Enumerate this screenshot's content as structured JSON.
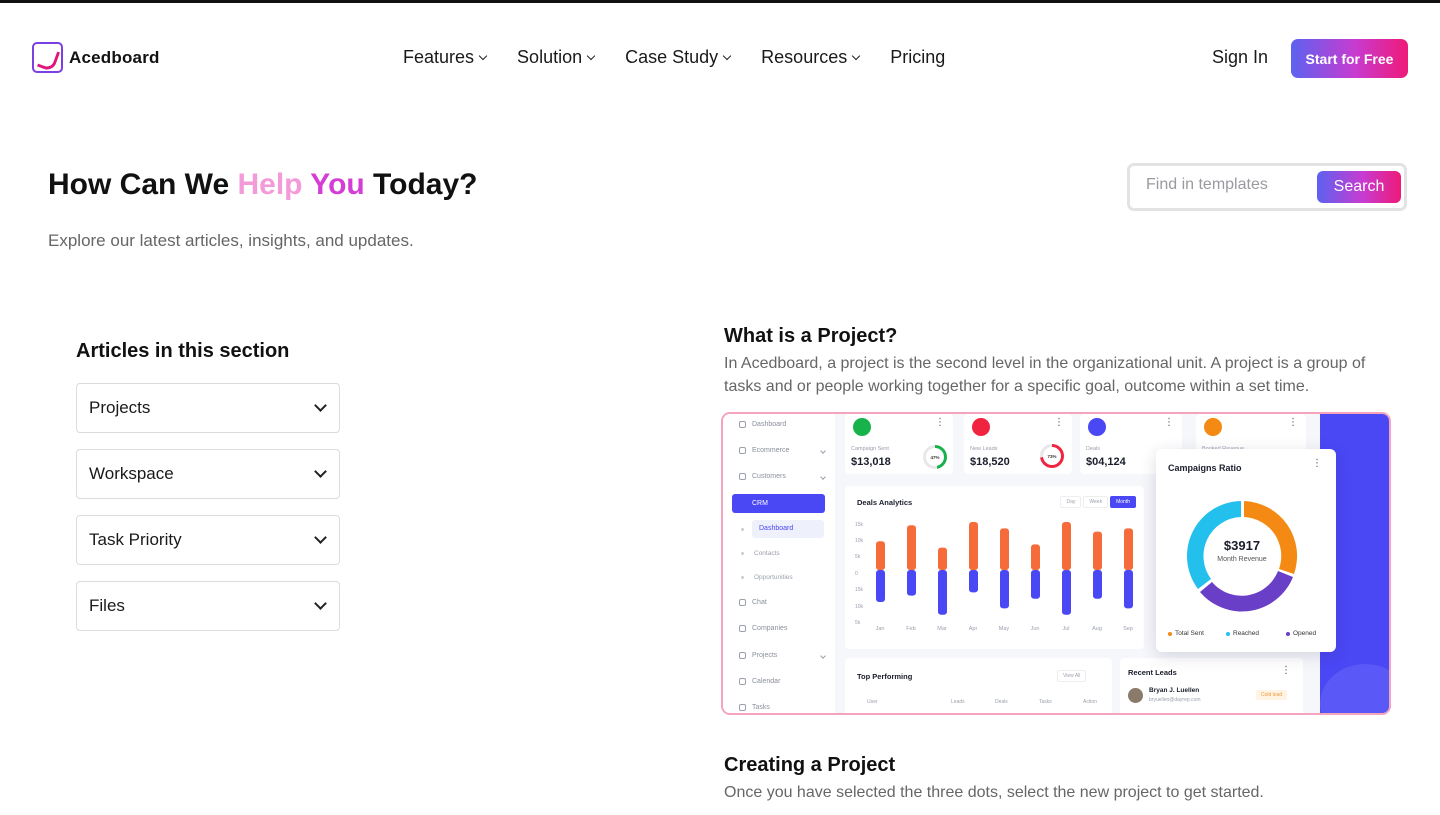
{
  "brand": {
    "name": "Acedboard"
  },
  "nav": {
    "items": [
      {
        "label": "Features",
        "dropdown": true
      },
      {
        "label": "Solution",
        "dropdown": true
      },
      {
        "label": "Case Study",
        "dropdown": true
      },
      {
        "label": "Resources",
        "dropdown": true
      },
      {
        "label": "Pricing",
        "dropdown": false
      }
    ],
    "sign_in": "Sign In",
    "cta": "Start for Free"
  },
  "hero": {
    "title_pre": "How Can We ",
    "title_hl1": "Help ",
    "title_hl2": "You",
    "title_post": " Today?",
    "subtitle": "Explore our latest articles, insights, and updates."
  },
  "search": {
    "placeholder": "Find in templates",
    "button": "Search"
  },
  "sidebar": {
    "title": "Articles in this section",
    "items": [
      "Projects",
      "Workspace",
      "Task Priority",
      "Files"
    ]
  },
  "article": {
    "h1": "What is a Project?",
    "p1": "In Acedboard, a project is the second level in the organizational unit. A project is a group of tasks and or people working together for a specific goal, outcome within a set time.",
    "h2": "Creating a Project",
    "p2": "Once you have selected the three dots, select the new project to get started."
  },
  "mock": {
    "menu": [
      "Dashboard",
      "Ecommerce",
      "Customers",
      "CRM",
      "Chat",
      "Companies",
      "Projects",
      "Calendar",
      "Tasks"
    ],
    "crm_sub": [
      "Dashboard",
      "Contacts",
      "Opportunities"
    ],
    "kpis": [
      {
        "label": "Campaign Sent",
        "value": "$13,018",
        "pct": "47%",
        "color": "#18b24b"
      },
      {
        "label": "New Leads",
        "value": "$18,520",
        "pct": "73%",
        "color": "#f1243f"
      },
      {
        "label": "Deals",
        "value": "$04,124",
        "pct": "",
        "color": "#4a47f5"
      },
      {
        "label": "Booked Revenue",
        "value": "",
        "pct": "",
        "color": "#f48a13"
      }
    ],
    "deals": {
      "title": "Deals Analytics",
      "tabs": [
        "Day",
        "Week",
        "Month"
      ],
      "y_ticks": [
        "15k",
        "10k",
        "5k",
        "0",
        "15k",
        "10k",
        "5k"
      ],
      "months": [
        "Jan",
        "Feb",
        "Mar",
        "Apr",
        "May",
        "Jun",
        "Jul",
        "Aug",
        "Sep"
      ],
      "upper": [
        9,
        14,
        7,
        15,
        13,
        8,
        15,
        12,
        13
      ],
      "lower": [
        10,
        8,
        14,
        7,
        12,
        9,
        14,
        9,
        12
      ],
      "colors": {
        "upper": "#f66b3a",
        "lower": "#4a47f5"
      }
    },
    "campaigns": {
      "title": "Campaigns Ratio",
      "value": "$3917",
      "label": "Month Revenue",
      "legend": [
        {
          "name": "Total Sent",
          "color": "#f48a13"
        },
        {
          "name": "Reached",
          "color": "#23c0ee"
        },
        {
          "name": "Opened",
          "color": "#6a3fc7"
        }
      ]
    },
    "top": {
      "title": "Top Performing",
      "btn": "View All",
      "cols": [
        "User",
        "Leads",
        "Deals",
        "Tasks",
        "Action"
      ]
    },
    "leads": {
      "title": "Recent Leads",
      "name": "Bryan J. Luellen",
      "email": "bryuellen@dayrep.com",
      "tag": "Cold lead"
    }
  }
}
